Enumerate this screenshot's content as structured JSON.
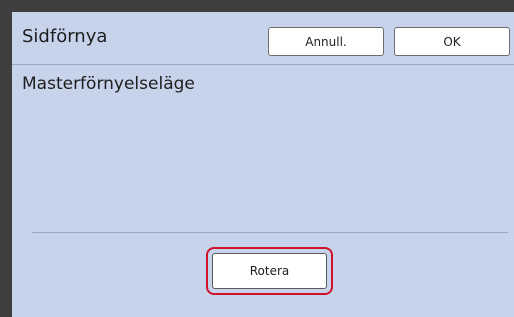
{
  "header": {
    "title": "Sidförnya",
    "cancel_label": "Annull.",
    "ok_label": "OK"
  },
  "main": {
    "mode_label": "Masterförnyelseläge",
    "rotate_label": "Rotera"
  },
  "colors": {
    "panel_background": "#c6d3ea",
    "highlight_border": "#d0122d",
    "frame": "#3e3e3e"
  }
}
